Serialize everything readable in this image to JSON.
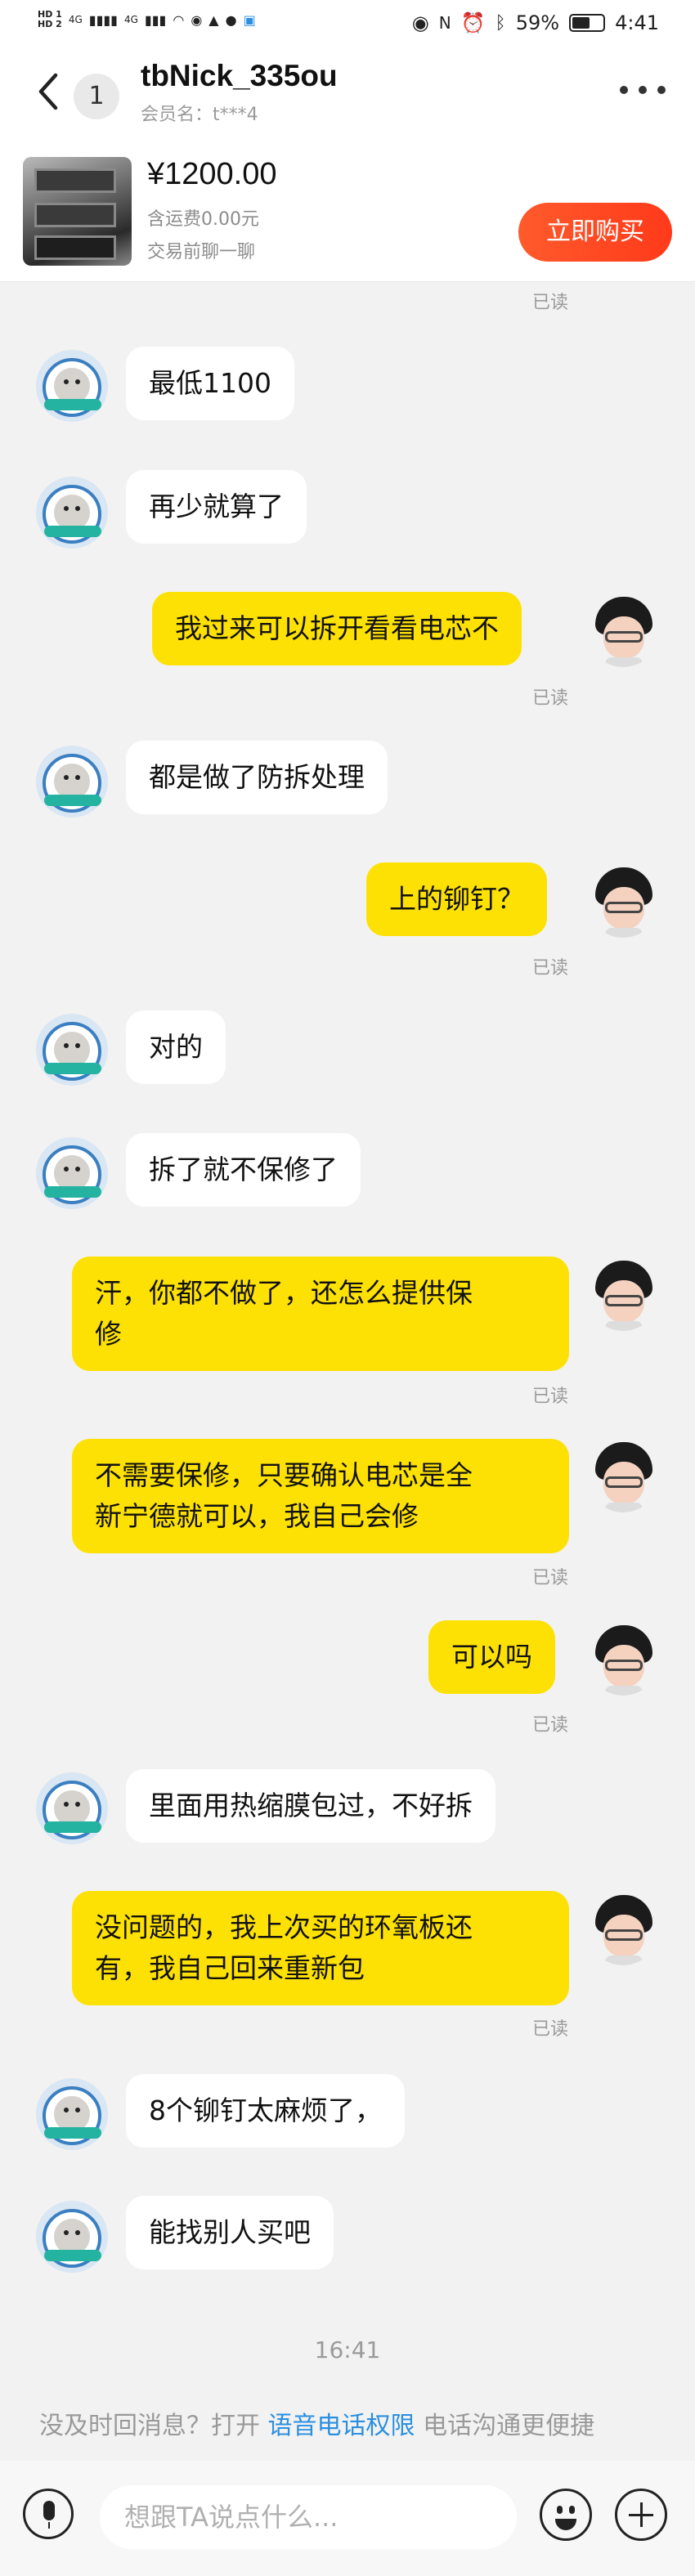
{
  "status_bar": {
    "hd1": "HD 1",
    "hd2": "HD 2",
    "signal1": "4G",
    "signal2": "4G",
    "battery_percent": "59%",
    "battery_level": 0.59,
    "time": "4:41"
  },
  "header": {
    "back_icon": "chevron-left-icon",
    "unread_count": "1",
    "nickname": "tbNick_335ou",
    "member_label": "会员名：t***4",
    "more_icon": "more-dots-icon"
  },
  "product": {
    "price": "¥1200.00",
    "shipping": "含运费0.00元",
    "chat_before": "交易前聊一聊",
    "buy_button": "立即购买"
  },
  "read_label": "已读",
  "messages": [
    {
      "side": "left",
      "text": "最低1100"
    },
    {
      "side": "left",
      "text": "再少就算了"
    },
    {
      "side": "right",
      "text": "我过来可以拆开看看电芯不",
      "read": true
    },
    {
      "side": "left",
      "text": "都是做了防拆处理"
    },
    {
      "side": "right",
      "text": "上的铆钉？",
      "read": true
    },
    {
      "side": "left",
      "text": "对的"
    },
    {
      "side": "left",
      "text": "拆了就不保修了"
    },
    {
      "side": "right",
      "text_line1": "汗，你都不做了，还怎么提供保",
      "text_line2": "修",
      "read": true
    },
    {
      "side": "right",
      "text_line1": "不需要保修，只要确认电芯是全",
      "text_line2": "新宁德就可以，我自己会修",
      "read": true
    },
    {
      "side": "right",
      "text": "可以吗",
      "read": true
    },
    {
      "side": "left",
      "text": "里面用热缩膜包过，不好拆"
    },
    {
      "side": "right",
      "text_line1": "没问题的，我上次买的环氧板还",
      "text_line2": "有，我自己回来重新包",
      "read": true
    },
    {
      "side": "left",
      "text": "8个铆钉太麻烦了，"
    },
    {
      "side": "left",
      "text": "能找别人买吧"
    }
  ],
  "timestamp": "16:41",
  "voice_tip": {
    "prefix": "没及时回消息？打开",
    "link": "语音电话权限",
    "suffix": "电话沟通更便捷"
  },
  "input_bar": {
    "placeholder": "想跟TA说点什么...",
    "value": "",
    "mic_icon": "microphone-icon",
    "emoji_icon": "emoji-icon",
    "plus_icon": "plus-icon"
  }
}
